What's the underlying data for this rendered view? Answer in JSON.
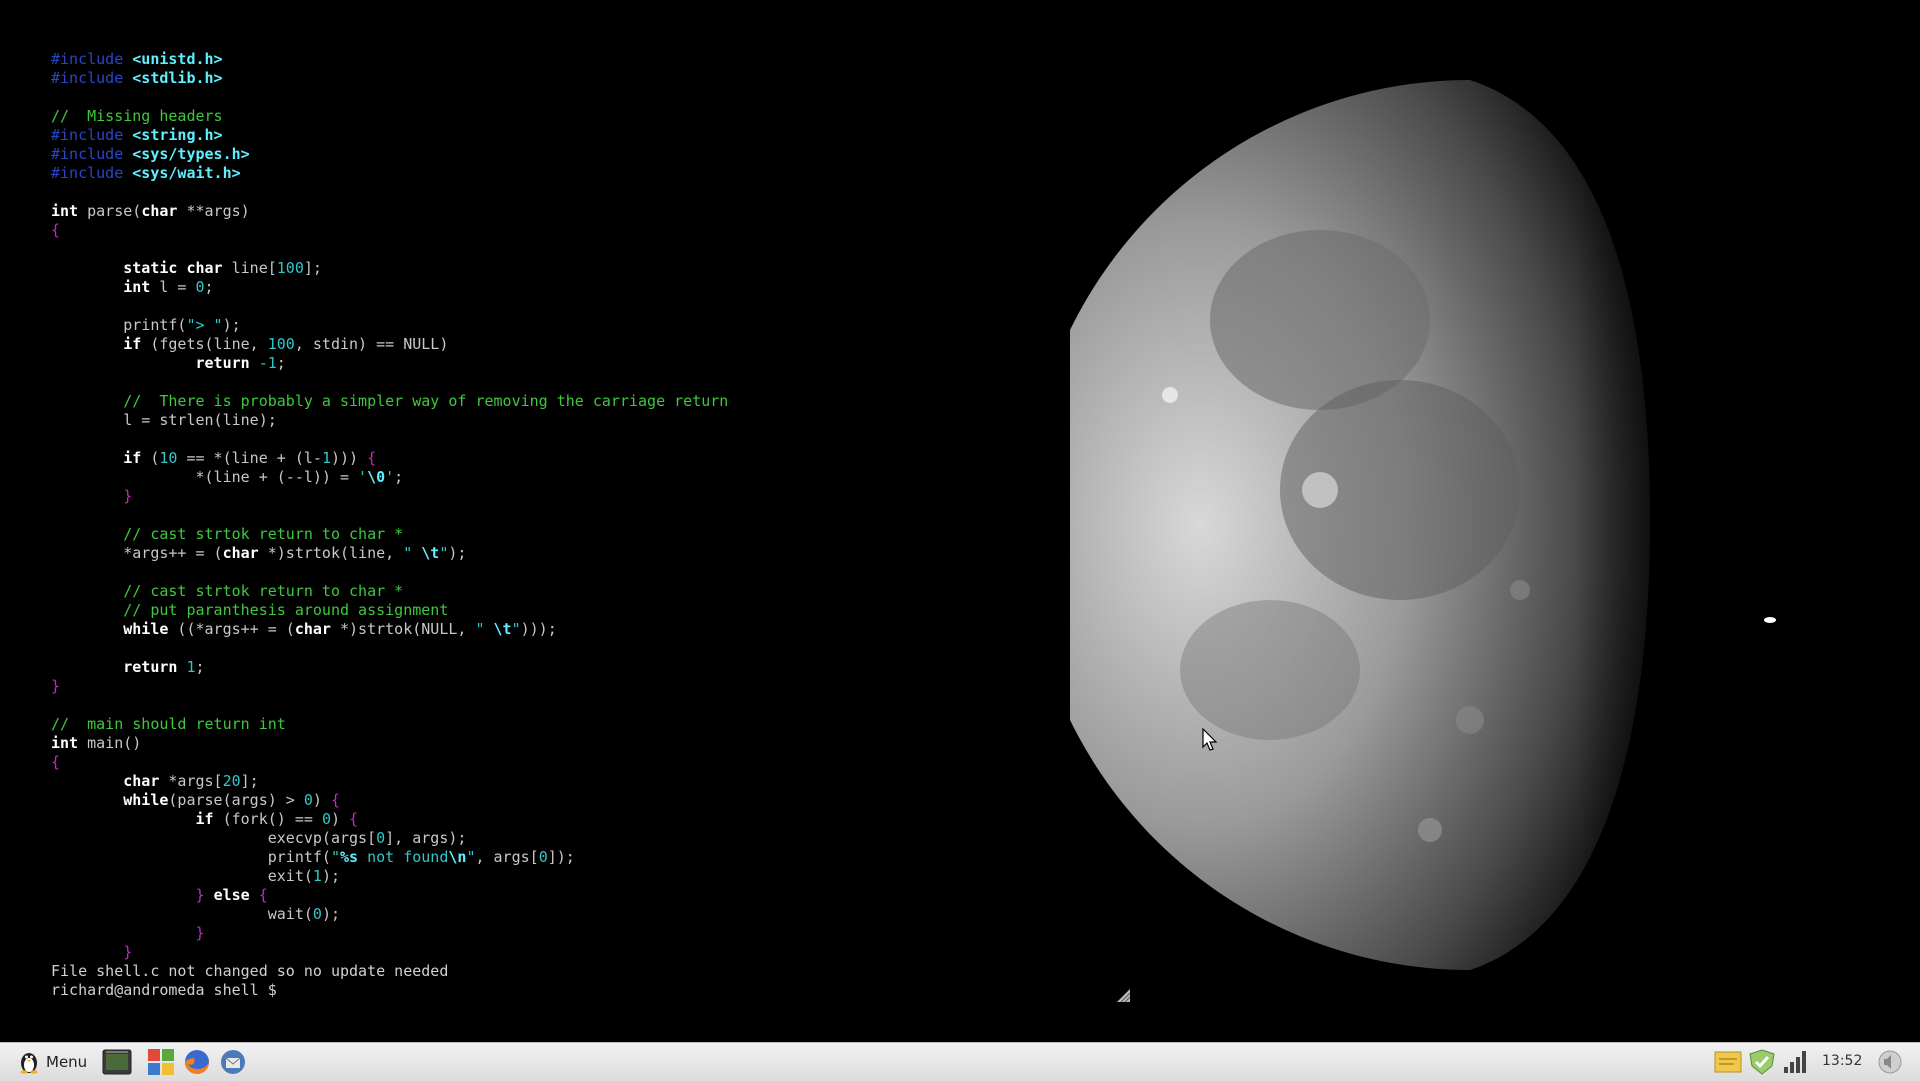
{
  "terminal": {
    "lines": [
      [
        [
          "pp",
          "#include "
        ],
        [
          "hdr",
          "<unistd.h>"
        ]
      ],
      [
        [
          "pp",
          "#include "
        ],
        [
          "hdr",
          "<stdlib.h>"
        ]
      ],
      [],
      [
        [
          "cmt",
          "//  Missing headers"
        ]
      ],
      [
        [
          "pp",
          "#include "
        ],
        [
          "hdr",
          "<string.h>"
        ]
      ],
      [
        [
          "pp",
          "#include "
        ],
        [
          "hdr",
          "<sys/types.h>"
        ]
      ],
      [
        [
          "pp",
          "#include "
        ],
        [
          "hdr",
          "<sys/wait.h>"
        ]
      ],
      [],
      [
        [
          "kw",
          "int"
        ],
        [
          "t",
          " parse("
        ],
        [
          "kw",
          "char"
        ],
        [
          "t",
          " **args)"
        ]
      ],
      [
        [
          "br",
          "{"
        ]
      ],
      [],
      [
        [
          "t",
          "        "
        ],
        [
          "kw",
          "static char"
        ],
        [
          "t",
          " line["
        ],
        [
          "num",
          "100"
        ],
        [
          "t",
          "];"
        ]
      ],
      [
        [
          "t",
          "        "
        ],
        [
          "kw",
          "int"
        ],
        [
          "t",
          " l = "
        ],
        [
          "num",
          "0"
        ],
        [
          "t",
          ";"
        ]
      ],
      [],
      [
        [
          "t",
          "        printf("
        ],
        [
          "str",
          "\"> \""
        ],
        [
          "t",
          ");"
        ]
      ],
      [
        [
          "t",
          "        "
        ],
        [
          "kw",
          "if"
        ],
        [
          "t",
          " (fgets(line, "
        ],
        [
          "num",
          "100"
        ],
        [
          "t",
          ", stdin) == NULL)"
        ]
      ],
      [
        [
          "t",
          "                "
        ],
        [
          "kw",
          "return"
        ],
        [
          "t",
          " "
        ],
        [
          "num",
          "-1"
        ],
        [
          "t",
          ";"
        ]
      ],
      [],
      [
        [
          "t",
          "        "
        ],
        [
          "cmt",
          "//  There is probably a simpler way of removing the carriage return"
        ]
      ],
      [
        [
          "t",
          "        l = strlen(line);"
        ]
      ],
      [],
      [
        [
          "t",
          "        "
        ],
        [
          "kw",
          "if"
        ],
        [
          "t",
          " ("
        ],
        [
          "num",
          "10"
        ],
        [
          "t",
          " == *(line + (l-"
        ],
        [
          "num",
          "1"
        ],
        [
          "t",
          "))) "
        ],
        [
          "br",
          "{"
        ]
      ],
      [
        [
          "t",
          "                *(line + (--l)) = "
        ],
        [
          "str",
          "'"
        ],
        [
          "esc",
          "\\0"
        ],
        [
          "str",
          "'"
        ],
        [
          "t",
          ";"
        ]
      ],
      [
        [
          "t",
          "        "
        ],
        [
          "br",
          "}"
        ]
      ],
      [],
      [
        [
          "t",
          "        "
        ],
        [
          "cmt",
          "// cast strtok return to char *"
        ]
      ],
      [
        [
          "t",
          "        *args++ = ("
        ],
        [
          "kw",
          "char"
        ],
        [
          "t",
          " *)strtok(line, "
        ],
        [
          "str",
          "\" "
        ],
        [
          "esc",
          "\\t"
        ],
        [
          "str",
          "\""
        ],
        [
          "t",
          ");"
        ]
      ],
      [],
      [
        [
          "t",
          "        "
        ],
        [
          "cmt",
          "// cast strtok return to char *"
        ]
      ],
      [
        [
          "t",
          "        "
        ],
        [
          "cmt",
          "// put paranthesis around assignment"
        ]
      ],
      [
        [
          "t",
          "        "
        ],
        [
          "kw",
          "while"
        ],
        [
          "t",
          " ((*args++ = ("
        ],
        [
          "kw",
          "char"
        ],
        [
          "t",
          " *)strtok(NULL, "
        ],
        [
          "str",
          "\" "
        ],
        [
          "esc",
          "\\t"
        ],
        [
          "str",
          "\""
        ],
        [
          "t",
          ")));"
        ]
      ],
      [],
      [
        [
          "t",
          "        "
        ],
        [
          "kw",
          "return"
        ],
        [
          "t",
          " "
        ],
        [
          "num",
          "1"
        ],
        [
          "t",
          ";"
        ]
      ],
      [
        [
          "br",
          "}"
        ]
      ],
      [],
      [
        [
          "cmt",
          "//  main should return int"
        ]
      ],
      [
        [
          "kw",
          "int"
        ],
        [
          "t",
          " main()"
        ]
      ],
      [
        [
          "br",
          "{"
        ]
      ],
      [
        [
          "t",
          "        "
        ],
        [
          "kw",
          "char"
        ],
        [
          "t",
          " *args["
        ],
        [
          "num",
          "20"
        ],
        [
          "t",
          "];"
        ]
      ],
      [
        [
          "t",
          "        "
        ],
        [
          "kw",
          "while"
        ],
        [
          "t",
          "(parse(args) > "
        ],
        [
          "num",
          "0"
        ],
        [
          "t",
          ") "
        ],
        [
          "br",
          "{"
        ]
      ],
      [
        [
          "t",
          "                "
        ],
        [
          "kw",
          "if"
        ],
        [
          "t",
          " (fork() == "
        ],
        [
          "num",
          "0"
        ],
        [
          "t",
          ") "
        ],
        [
          "br",
          "{"
        ]
      ],
      [
        [
          "t",
          "                        execvp(args["
        ],
        [
          "num",
          "0"
        ],
        [
          "t",
          "], args);"
        ]
      ],
      [
        [
          "t",
          "                        printf("
        ],
        [
          "str",
          "\""
        ],
        [
          "esc",
          "%s"
        ],
        [
          "str",
          " not found"
        ],
        [
          "esc",
          "\\n"
        ],
        [
          "str",
          "\""
        ],
        [
          "t",
          ", args["
        ],
        [
          "num",
          "0"
        ],
        [
          "t",
          "]);"
        ]
      ],
      [
        [
          "t",
          "                        exit("
        ],
        [
          "num",
          "1"
        ],
        [
          "t",
          ");"
        ]
      ],
      [
        [
          "t",
          "                "
        ],
        [
          "br",
          "}"
        ],
        [
          "t",
          " "
        ],
        [
          "kw",
          "else"
        ],
        [
          "t",
          " "
        ],
        [
          "br",
          "{"
        ]
      ],
      [
        [
          "t",
          "                        wait("
        ],
        [
          "num",
          "0"
        ],
        [
          "t",
          ");"
        ]
      ],
      [
        [
          "t",
          "                "
        ],
        [
          "br",
          "}"
        ]
      ],
      [
        [
          "t",
          "        "
        ],
        [
          "br",
          "}"
        ]
      ],
      [
        [
          "out",
          "File shell.c not changed so no update needed"
        ]
      ],
      [
        [
          "out",
          "richard@andromeda shell $ "
        ]
      ]
    ]
  },
  "taskbar": {
    "menu_label": "Menu",
    "clock": "13:52",
    "launchers": [
      "terminal-icon",
      "software-manager-icon",
      "firefox-icon",
      "thunderbird-icon"
    ],
    "tray": [
      "notes-icon",
      "update-manager-icon",
      "network-signal-icon",
      "sound-icon"
    ]
  }
}
